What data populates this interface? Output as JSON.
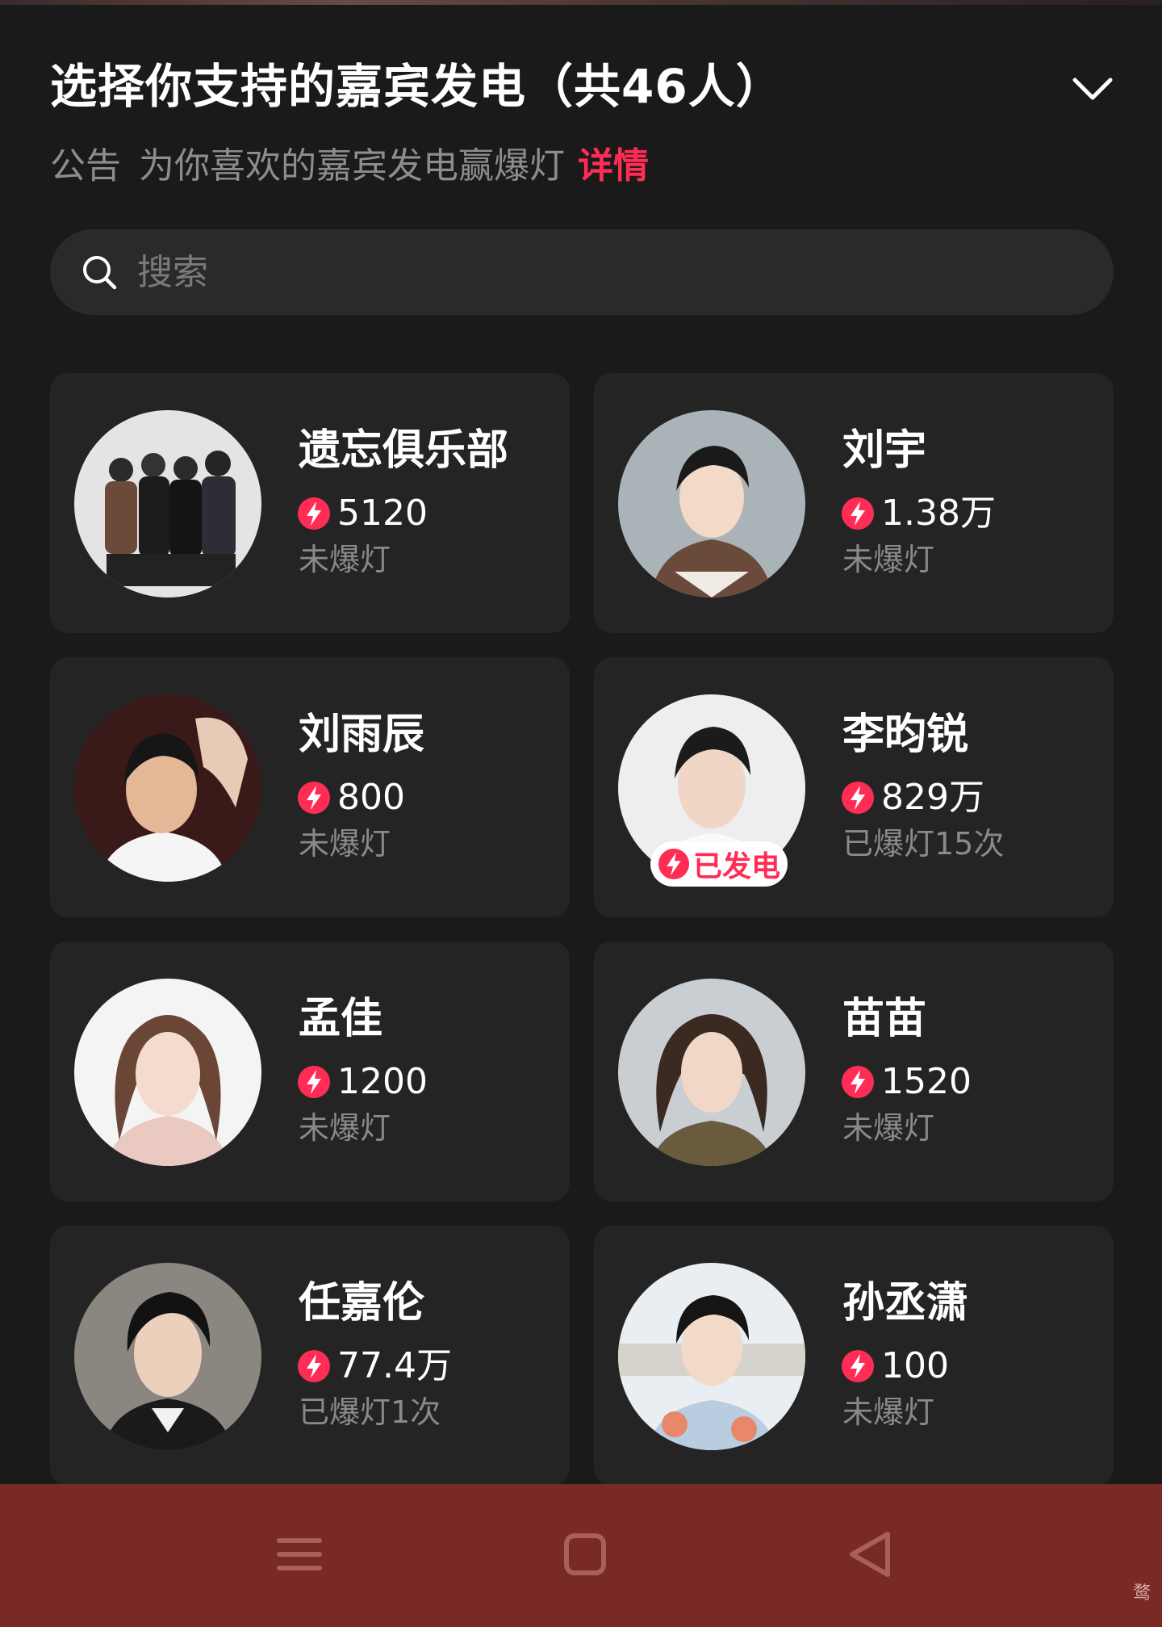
{
  "header": {
    "title": "选择你支持的嘉宾发电（共46人）",
    "collapse_icon": "chevron-down-icon"
  },
  "notice": {
    "label": "公告",
    "text": "为你喜欢的嘉宾发电赢爆灯",
    "details_link": "详情"
  },
  "search": {
    "placeholder": "搜索",
    "value": ""
  },
  "colors": {
    "background": "#1a1a1a",
    "card": "#242424",
    "accent": "#ff2d55",
    "navbar": "#7a2a24"
  },
  "guests": [
    {
      "name": "遗忘俱乐部",
      "power": "5120",
      "status": "未爆灯"
    },
    {
      "name": "刘宇",
      "power": "1.38万",
      "status": "未爆灯"
    },
    {
      "name": "刘雨辰",
      "power": "800",
      "status": "未爆灯"
    },
    {
      "name": "李昀锐",
      "power": "829万",
      "status": "已爆灯15次",
      "badge": "已发电"
    },
    {
      "name": "孟佳",
      "power": "1200",
      "status": "未爆灯"
    },
    {
      "name": "苗苗",
      "power": "1520",
      "status": "未爆灯"
    },
    {
      "name": "任嘉伦",
      "power": "77.4万",
      "status": "已爆灯1次"
    },
    {
      "name": "孙丞潇",
      "power": "100",
      "status": "未爆灯"
    }
  ],
  "navbar": {
    "menu_icon": "menu-icon",
    "home_icon": "home-icon",
    "back_icon": "back-icon"
  },
  "watermark": "鹜"
}
